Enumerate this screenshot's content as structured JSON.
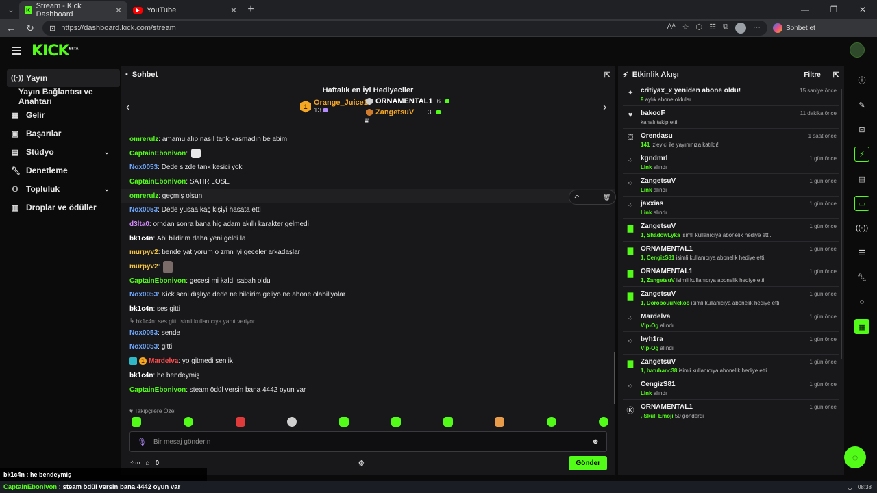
{
  "browser": {
    "tabs": [
      {
        "title": "Stream - Kick Dashboard"
      },
      {
        "title": "YouTube"
      }
    ],
    "url": "https://dashboard.kick.com/stream",
    "copilot_label": "Sohbet et"
  },
  "header": {
    "logo": "KICK",
    "logo_badge": "BETA"
  },
  "sidebar": {
    "items": [
      {
        "label": "Yayın",
        "icon": "broadcast-icon"
      },
      {
        "label": "Yayın Bağlantısı ve Anahtarı",
        "icon": ""
      },
      {
        "label": "Gelir",
        "icon": "chart-icon"
      },
      {
        "label": "Başarılar",
        "icon": "trophy-icon"
      },
      {
        "label": "Stüdyo",
        "icon": "studio-icon"
      },
      {
        "label": "Denetleme",
        "icon": "wrench-icon"
      },
      {
        "label": "Topluluk",
        "icon": "community-icon"
      },
      {
        "label": "Droplar ve ödüller",
        "icon": "gift-icon"
      }
    ]
  },
  "chat": {
    "title": "Sohbet",
    "gifters_title": "Haftalık en İyi Hediyeciler",
    "gifters": [
      {
        "rank": "1",
        "name": "Orange_Juice1",
        "count": "13",
        "color": "#f5a623"
      },
      {
        "rank": "2",
        "name": "ORNAMENTAL1",
        "count": "6",
        "color": "#ffffff"
      },
      {
        "rank": "3",
        "name": "ZangetsuV",
        "count": "3",
        "color": "#f5a623"
      }
    ],
    "messages": [
      {
        "user": "omrerulz",
        "color": "#53fc18",
        "text": "amamu alıp nasıl tank kasmadın be abim"
      },
      {
        "user": "CaptainEbonivon",
        "color": "#53fc18",
        "text": ""
      },
      {
        "user": "Nox0053",
        "color": "#6ea8ff",
        "text": "Dede sizde tank kesici yok"
      },
      {
        "user": "CaptainEbonivon",
        "color": "#53fc18",
        "text": "SATIR LOSE"
      },
      {
        "user": "omrerulz",
        "color": "#53fc18",
        "text": "geçmiş olsun"
      },
      {
        "user": "Nox0053",
        "color": "#6ea8ff",
        "text": "Dede yusaa kaç kişiyi hasata etti"
      },
      {
        "user": "d3lta0",
        "color": "#d78cff",
        "text": "orndan sonra bana hiç adam akıllı karakter gelmedi"
      },
      {
        "user": "bk1c4n",
        "color": "#ffffff",
        "text": "Abi bildirim daha yeni geldi la"
      },
      {
        "user": "murpyv2",
        "color": "#f5c542",
        "text": "bende yatıyorum o zmn iyi geceler arkadaşlar"
      },
      {
        "user": "murpyv2",
        "color": "#f5c542",
        "text": ""
      },
      {
        "user": "CaptainEbonivon",
        "color": "#53fc18",
        "text": "gecesi mi kaldı sabah oldu"
      },
      {
        "user": "Nox0053",
        "color": "#6ea8ff",
        "text": "Kick seni dışlıyo dede ne bildirim geliyo ne abone olabiliyolar"
      },
      {
        "user": "bk1c4n",
        "color": "#ffffff",
        "text": "ses gitti"
      }
    ],
    "reply_note": "bk1c4n: ses gitti isimli kullanıcıya yanıt veriyor",
    "messages_after": [
      {
        "user": "Nox0053",
        "color": "#6ea8ff",
        "text": "sende"
      },
      {
        "user": "Nox0053",
        "color": "#6ea8ff",
        "text": "gitti"
      },
      {
        "user": "Mardelva",
        "color": "#ff4d4d",
        "text": "yo gitmedi senlik"
      },
      {
        "user": "bk1c4n",
        "color": "#ffffff",
        "text": "he bendeymiş"
      },
      {
        "user": "CaptainEbonivon",
        "color": "#53fc18",
        "text": "steam ödül versin bana 4442 oyun var"
      }
    ],
    "followers_only": "Takipçilere Özel",
    "input_placeholder": "Bir mesaj gönderin",
    "footer_count": "0",
    "send_label": "Gönder"
  },
  "activity": {
    "title": "Etkinlik Akışı",
    "filter_label": "Filtre",
    "items": [
      {
        "icon": "sparkle-icon",
        "name": "critiyax_x yeniden abone oldu!",
        "time": "15 saniye önce",
        "hl": "9",
        "sub": "aylık abone oldular"
      },
      {
        "icon": "heart-icon",
        "name": "bakooF",
        "time": "11 dakika önce",
        "hl": "",
        "sub": "kanalı takip etti"
      },
      {
        "icon": "raid-icon",
        "name": "Orendasu",
        "time": "1 saat önce",
        "hl": "141",
        "sub": "izleyici ile yayınınıza katıldı!"
      },
      {
        "icon": "reward-icon",
        "name": "kgndmrl",
        "time": "1 gün önce",
        "hl": "Link",
        "sub": "alındı"
      },
      {
        "icon": "reward-icon",
        "name": "ZangetsuV",
        "time": "1 gün önce",
        "hl": "Link",
        "sub": "alındı"
      },
      {
        "icon": "reward-icon",
        "name": "jaxxias",
        "time": "1 gün önce",
        "hl": "Link",
        "sub": "alındı"
      },
      {
        "icon": "gift-icon",
        "name": "ZangetsuV",
        "time": "1 gün önce",
        "hl": "1, ShadowLyka",
        "sub": "isimli kullanıcıya abonelik hediye etti."
      },
      {
        "icon": "gift-icon",
        "name": "ORNAMENTAL1",
        "time": "1 gün önce",
        "hl": "1, CengizS81",
        "sub": "isimli kullanıcıya abonelik hediye etti."
      },
      {
        "icon": "gift-icon",
        "name": "ORNAMENTAL1",
        "time": "1 gün önce",
        "hl": "1, ZangetsuV",
        "sub": "isimli kullanıcıya abonelik hediye etti."
      },
      {
        "icon": "gift-icon",
        "name": "ZangetsuV",
        "time": "1 gün önce",
        "hl": "1, DorobouuNekoo",
        "sub": "isimli kullanıcıya abonelik hediye etti."
      },
      {
        "icon": "reward-icon",
        "name": "Mardelva",
        "time": "1 gün önce",
        "hl": "Vİp-Og",
        "sub": "alındı"
      },
      {
        "icon": "reward-icon",
        "name": "byh1ra",
        "time": "1 gün önce",
        "hl": "Vİp-Og",
        "sub": "alındı"
      },
      {
        "icon": "gift-icon",
        "name": "ZangetsuV",
        "time": "1 gün önce",
        "hl": "1, batuhanc38",
        "sub": "isimli kullanıcıya abonelik hediye etti."
      },
      {
        "icon": "reward-icon",
        "name": "CengizS81",
        "time": "1 gün önce",
        "hl": "Link",
        "sub": "alındı"
      },
      {
        "icon": "kick-icon",
        "name": "ORNAMENTAL1",
        "time": "1 gün önce",
        "hl": ", Skull Emoji",
        "sub": "50 gönderdi"
      }
    ]
  },
  "overlay": {
    "line1": "bk1c4n : he bendeymiş",
    "line2_user": "CaptainEbonivon",
    "line2_text": ": steam ödül versin bana 4442 oyun var"
  },
  "taskbar": {
    "time": "08:38"
  },
  "colors": {
    "accent": "#53fc18",
    "panel": "#18181b",
    "bg": "#0b0b0c"
  }
}
